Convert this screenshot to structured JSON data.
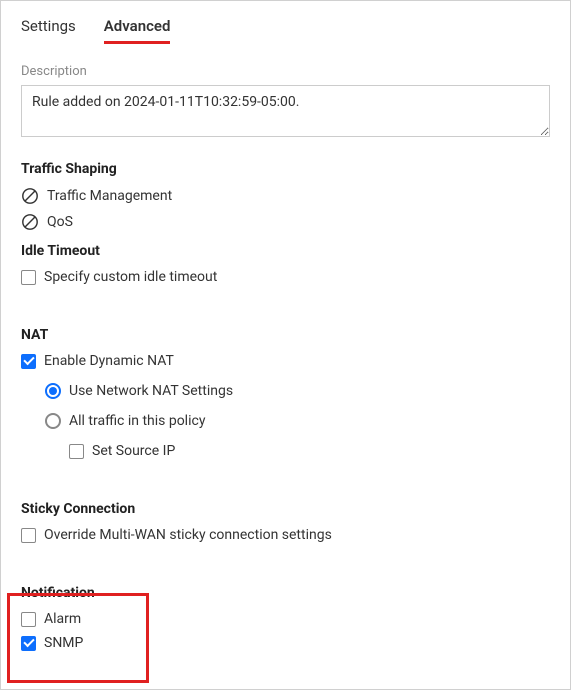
{
  "tabs": {
    "settings": "Settings",
    "advanced": "Advanced"
  },
  "description": {
    "label": "Description",
    "value": "Rule added on 2024-01-11T10:32:59-05:00."
  },
  "traffic_shaping": {
    "heading": "Traffic Shaping",
    "traffic_management": "Traffic Management",
    "qos": "QoS"
  },
  "idle_timeout": {
    "heading": "Idle Timeout",
    "specify_custom": "Specify custom idle timeout"
  },
  "nat": {
    "heading": "NAT",
    "enable_dynamic": "Enable Dynamic NAT",
    "use_network": "Use Network NAT Settings",
    "all_traffic": "All traffic in this policy",
    "set_source_ip": "Set Source IP"
  },
  "sticky": {
    "heading": "Sticky Connection",
    "override": "Override Multi-WAN sticky connection settings"
  },
  "notification": {
    "heading": "Notification",
    "alarm": "Alarm",
    "snmp": "SNMP"
  }
}
